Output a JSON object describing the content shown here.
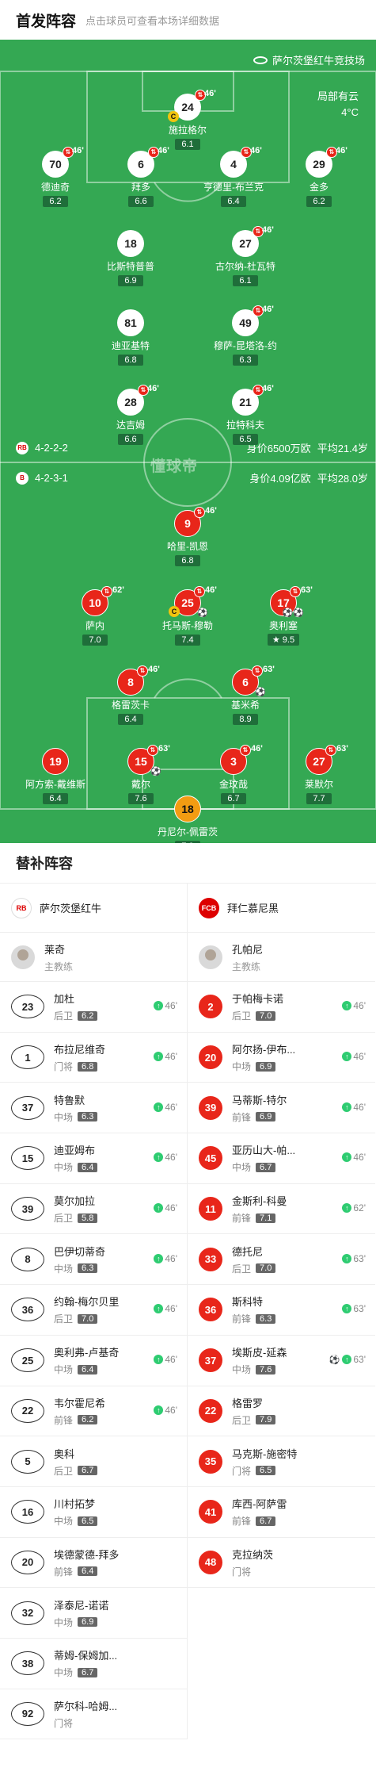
{
  "header": {
    "title": "首发阵容",
    "subtitle": "点击球员可查看本场详细数据"
  },
  "pitch": {
    "stadium": "萨尔茨堡红牛竞技场",
    "weather": {
      "condition": "局部有云",
      "temperature": "4°C"
    },
    "watermark": "懂球帝",
    "home": {
      "formation": "4-2-2-2",
      "value": "身价6500万欧",
      "age": "平均21.4岁"
    },
    "away": {
      "formation": "4-2-3-1",
      "value": "身价4.09亿欧",
      "age": "平均28.0岁"
    }
  },
  "players": [
    {
      "num": "24",
      "name": "施拉格尔",
      "rating": "6.1",
      "team": "home",
      "captain": true,
      "sub": "46'"
    },
    {
      "num": "70",
      "name": "德迪奇",
      "rating": "6.2",
      "team": "home",
      "sub": "46'"
    },
    {
      "num": "6",
      "name": "拜多",
      "rating": "6.6",
      "team": "home",
      "sub": "46'"
    },
    {
      "num": "4",
      "name": "亨德里-布兰克",
      "rating": "6.4",
      "team": "home",
      "sub": "46'"
    },
    {
      "num": "29",
      "name": "金多",
      "rating": "6.2",
      "team": "home",
      "sub": "46'"
    },
    {
      "num": "18",
      "name": "比斯特普普",
      "rating": "6.9",
      "team": "home"
    },
    {
      "num": "27",
      "name": "古尔纳-杜瓦特",
      "rating": "6.1",
      "team": "home",
      "sub": "46'"
    },
    {
      "num": "81",
      "name": "迪亚基特",
      "rating": "6.8",
      "team": "home"
    },
    {
      "num": "49",
      "name": "穆萨-昆塔洛-约",
      "rating": "6.3",
      "team": "home",
      "sub": "46'"
    },
    {
      "num": "28",
      "name": "达吉姆",
      "rating": "6.6",
      "team": "home",
      "sub": "46'"
    },
    {
      "num": "21",
      "name": "拉特科夫",
      "rating": "6.5",
      "team": "home",
      "sub": "46'"
    },
    {
      "num": "9",
      "name": "哈里-凯恩",
      "rating": "6.8",
      "team": "away",
      "sub": "46'"
    },
    {
      "num": "10",
      "name": "萨内",
      "rating": "7.0",
      "team": "away",
      "sub": "62'"
    },
    {
      "num": "25",
      "name": "托马斯-穆勒",
      "rating": "7.4",
      "team": "away",
      "captain": true,
      "goal": "⚽",
      "sub": "46'"
    },
    {
      "num": "17",
      "name": "奥利塞",
      "rating": "9.5",
      "team": "away",
      "star": true,
      "goal": "⚽⚽",
      "sub": "63'"
    },
    {
      "num": "8",
      "name": "格雷茨卡",
      "rating": "6.4",
      "team": "away",
      "sub": "46'"
    },
    {
      "num": "6",
      "name": "基米希",
      "rating": "8.9",
      "team": "away",
      "goal": "⚽",
      "sub": "63'"
    },
    {
      "num": "19",
      "name": "阿方索-戴维斯",
      "rating": "6.4",
      "team": "away"
    },
    {
      "num": "15",
      "name": "戴尔",
      "rating": "7.6",
      "team": "away",
      "goal": "⚽",
      "sub": "63'"
    },
    {
      "num": "3",
      "name": "金玟哉",
      "rating": "6.7",
      "team": "away",
      "sub": "46'"
    },
    {
      "num": "27",
      "name": "莱默尔",
      "rating": "7.7",
      "team": "away",
      "sub": "63'"
    },
    {
      "num": "18",
      "name": "丹尼尔-佩雷茨",
      "rating": "7.0",
      "team": "away",
      "gk": true
    }
  ],
  "subs_title": "替补阵容",
  "home_team": {
    "name": "萨尔茨堡红牛",
    "logo": "RB",
    "coach": "莱奇",
    "coach_role": "主教练"
  },
  "away_team": {
    "name": "拜仁慕尼黑",
    "logo": "FCB",
    "coach": "孔帕尼",
    "coach_role": "主教练"
  },
  "home_subs": [
    {
      "num": "23",
      "name": "加杜",
      "pos": "后卫",
      "rating": "6.2",
      "time": "46'"
    },
    {
      "num": "1",
      "name": "布拉尼维奇",
      "pos": "门将",
      "rating": "6.8",
      "time": "46'"
    },
    {
      "num": "37",
      "name": "特鲁默",
      "pos": "中场",
      "rating": "6.3",
      "time": "46'"
    },
    {
      "num": "15",
      "name": "迪亚姆布",
      "pos": "中场",
      "rating": "6.4",
      "time": "46'"
    },
    {
      "num": "39",
      "name": "莫尔加拉",
      "pos": "后卫",
      "rating": "5.8",
      "time": "46'"
    },
    {
      "num": "8",
      "name": "巴伊切蒂奇",
      "pos": "中场",
      "rating": "6.3",
      "time": "46'"
    },
    {
      "num": "36",
      "name": "约翰-梅尔贝里",
      "pos": "后卫",
      "rating": "7.0",
      "time": "46'"
    },
    {
      "num": "25",
      "name": "奥利弗-卢基奇",
      "pos": "中场",
      "rating": "6.4",
      "time": "46'"
    },
    {
      "num": "22",
      "name": "韦尔霍尼希",
      "pos": "前锋",
      "rating": "6.2",
      "time": "46'"
    },
    {
      "num": "5",
      "name": "奥科",
      "pos": "后卫",
      "rating": "6.7",
      "time": ""
    },
    {
      "num": "16",
      "name": "川村拓梦",
      "pos": "中场",
      "rating": "6.5",
      "time": ""
    },
    {
      "num": "20",
      "name": "埃德蒙德-拜多",
      "pos": "前锋",
      "rating": "6.4",
      "time": ""
    },
    {
      "num": "32",
      "name": "泽泰尼-诺诺",
      "pos": "中场",
      "rating": "6.9",
      "time": ""
    },
    {
      "num": "38",
      "name": "蒂姆-保姆加...",
      "pos": "中场",
      "rating": "6.7",
      "time": ""
    },
    {
      "num": "92",
      "name": "萨尔科-哈姆...",
      "pos": "门将",
      "rating": "",
      "time": ""
    }
  ],
  "away_subs": [
    {
      "num": "2",
      "name": "于帕梅卡诺",
      "pos": "后卫",
      "rating": "7.0",
      "time": "46'"
    },
    {
      "num": "20",
      "name": "阿尔扬-伊布...",
      "pos": "中场",
      "rating": "6.9",
      "time": "46'"
    },
    {
      "num": "39",
      "name": "马蒂斯-特尔",
      "pos": "前锋",
      "rating": "6.9",
      "time": "46'"
    },
    {
      "num": "45",
      "name": "亚历山大-帕...",
      "pos": "中场",
      "rating": "6.7",
      "time": "46'"
    },
    {
      "num": "11",
      "name": "金斯利-科曼",
      "pos": "前锋",
      "rating": "7.1",
      "time": "62'"
    },
    {
      "num": "33",
      "name": "德托尼",
      "pos": "后卫",
      "rating": "7.0",
      "time": "63'"
    },
    {
      "num": "36",
      "name": "斯科特",
      "pos": "前锋",
      "rating": "6.3",
      "time": "63'"
    },
    {
      "num": "37",
      "name": "埃斯皮-延森",
      "pos": "中场",
      "rating": "7.6",
      "time": "63'",
      "goal": "⚽"
    },
    {
      "num": "22",
      "name": "格雷罗",
      "pos": "后卫",
      "rating": "7.9",
      "time": ""
    },
    {
      "num": "35",
      "name": "马克斯-施密特",
      "pos": "门将",
      "rating": "6.5",
      "time": ""
    },
    {
      "num": "41",
      "name": "库西-阿萨雷",
      "pos": "前锋",
      "rating": "6.7",
      "time": ""
    },
    {
      "num": "48",
      "name": "克拉纳茨",
      "pos": "门将",
      "rating": "",
      "time": ""
    }
  ]
}
